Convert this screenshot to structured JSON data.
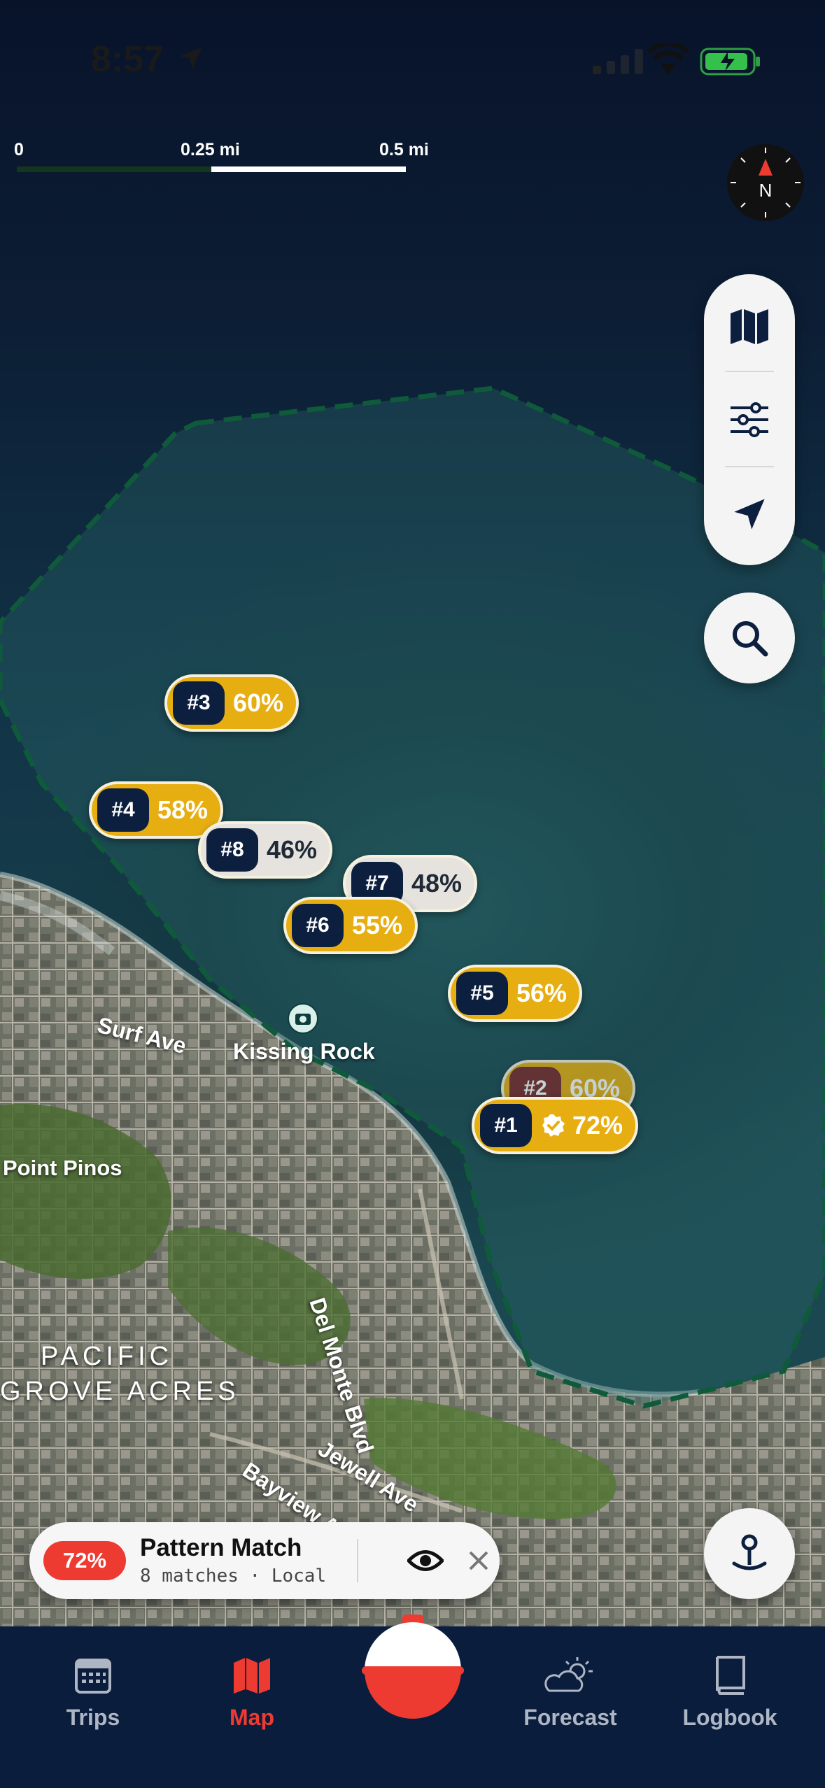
{
  "status_bar": {
    "time": "8:57"
  },
  "scale": {
    "labels": [
      "0",
      "0.25 mi",
      "0.5 mi"
    ]
  },
  "compass": {
    "label": "N"
  },
  "pins": [
    {
      "rank": "#3",
      "pct": "60%",
      "style": "gold"
    },
    {
      "rank": "#4",
      "pct": "58%",
      "style": "gold"
    },
    {
      "rank": "#8",
      "pct": "46%",
      "style": "grey"
    },
    {
      "rank": "#7",
      "pct": "48%",
      "style": "grey"
    },
    {
      "rank": "#6",
      "pct": "55%",
      "style": "gold"
    },
    {
      "rank": "#5",
      "pct": "56%",
      "style": "gold"
    },
    {
      "rank": "#2",
      "pct": "60%",
      "style": "gold"
    },
    {
      "rank": "#1",
      "pct": "72%",
      "style": "gold",
      "verified": true
    }
  ],
  "places": {
    "surf_ave": "Surf Ave",
    "kissing_rock": "Kissing Rock",
    "point_pinos": "Point Pinos",
    "del_monte": "Del Monte Blvd",
    "pacific_grove_1": "PACIFIC",
    "pacific_grove_2": "GROVE ACRES",
    "jewell_ave": "Jewell Ave",
    "bayview": "Bayview A"
  },
  "pattern_card": {
    "badge": "72%",
    "title": "Pattern Match",
    "subtitle": "8 matches · Local"
  },
  "tabs": [
    {
      "label": "Trips"
    },
    {
      "label": "Map"
    },
    {
      "label": "Forecast"
    },
    {
      "label": "Logbook"
    }
  ],
  "colors": {
    "accent": "#ee3b32",
    "pin_gold": "#e7ae12",
    "pin_rank": "#0d1f3f",
    "tabbar": "#0b1d3d",
    "zone_border": "#0f5a3a"
  }
}
